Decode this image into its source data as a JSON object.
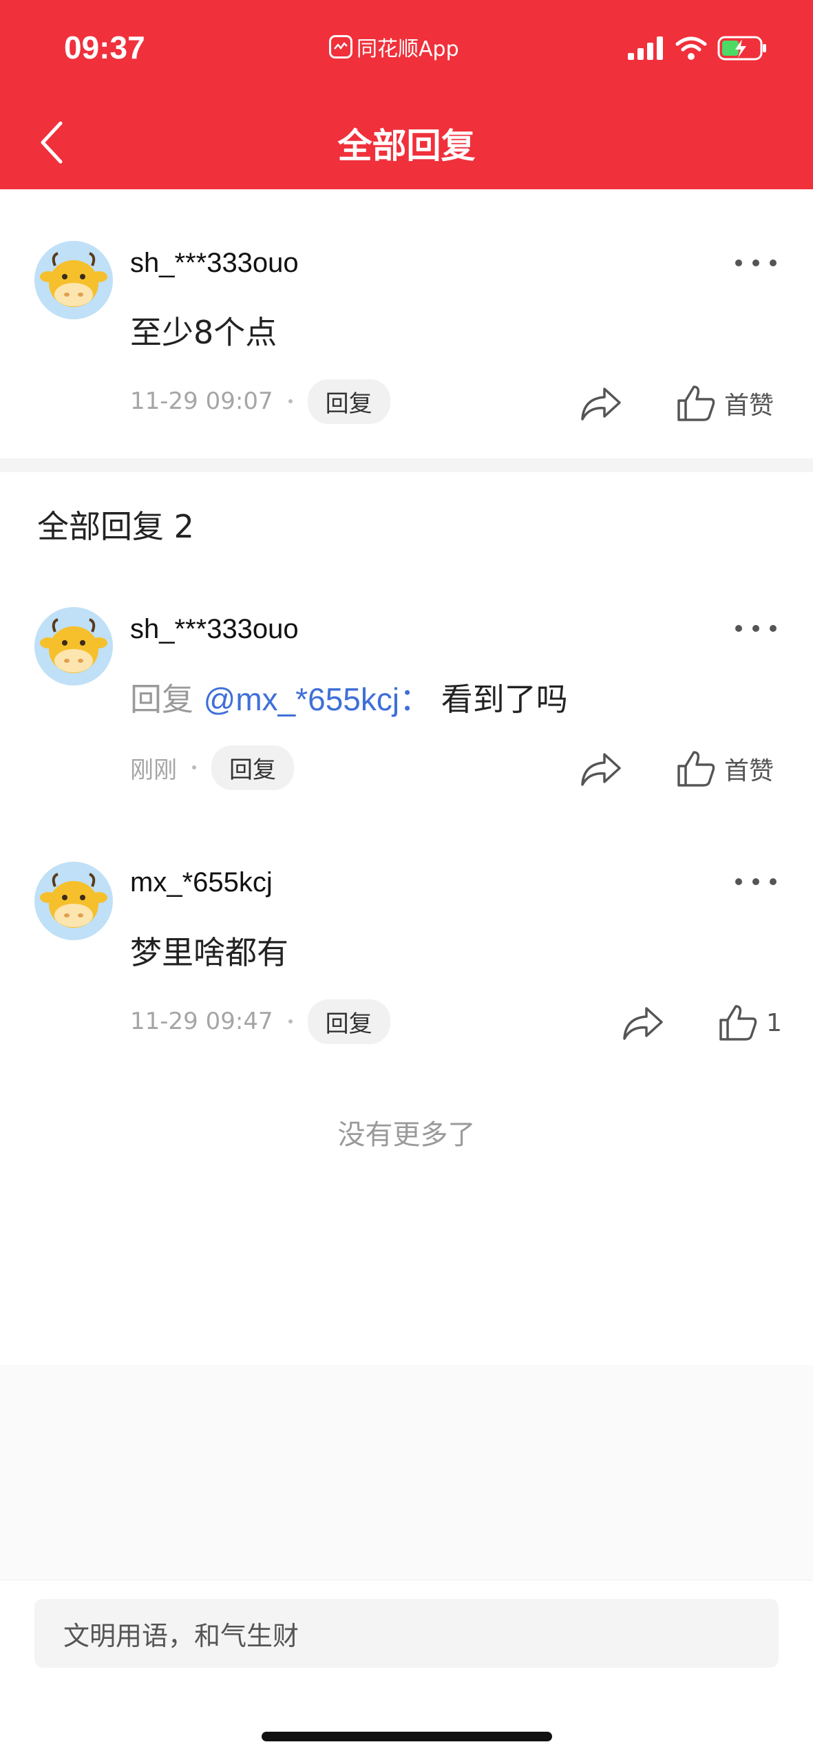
{
  "status_bar": {
    "time": "09:37",
    "app_name": "同花顺App"
  },
  "header": {
    "title": "全部回复"
  },
  "main_comment": {
    "username": "sh_***333ouo",
    "text": "至少8个点",
    "time": "11-29 09:07",
    "reply_label": "回复",
    "like_label": "首赞"
  },
  "replies_section": {
    "title": "全部回复 2"
  },
  "replies": [
    {
      "username": "sh_***333ouo",
      "reply_prefix": "回复",
      "mention": "@mx_*655kcj：",
      "text": "看到了吗",
      "time": "刚刚",
      "reply_label": "回复",
      "like_label": "首赞"
    },
    {
      "username": "mx_*655kcj",
      "text": "梦里啥都有",
      "time": "11-29 09:47",
      "reply_label": "回复",
      "like_label": "1"
    }
  ],
  "footer": {
    "no_more": "没有更多了",
    "input_placeholder": "文明用语，和气生财"
  },
  "colors": {
    "header_red": "#f0303b",
    "mention_blue": "#3f6fd8",
    "avatar_bg": "#bfe0f7",
    "cow_yellow": "#f6c02c"
  },
  "icons": [
    "signal-icon",
    "wifi-icon",
    "battery-icon",
    "back-icon",
    "more-icon",
    "share-icon",
    "thumbs-up-icon",
    "cow-avatar-icon"
  ]
}
